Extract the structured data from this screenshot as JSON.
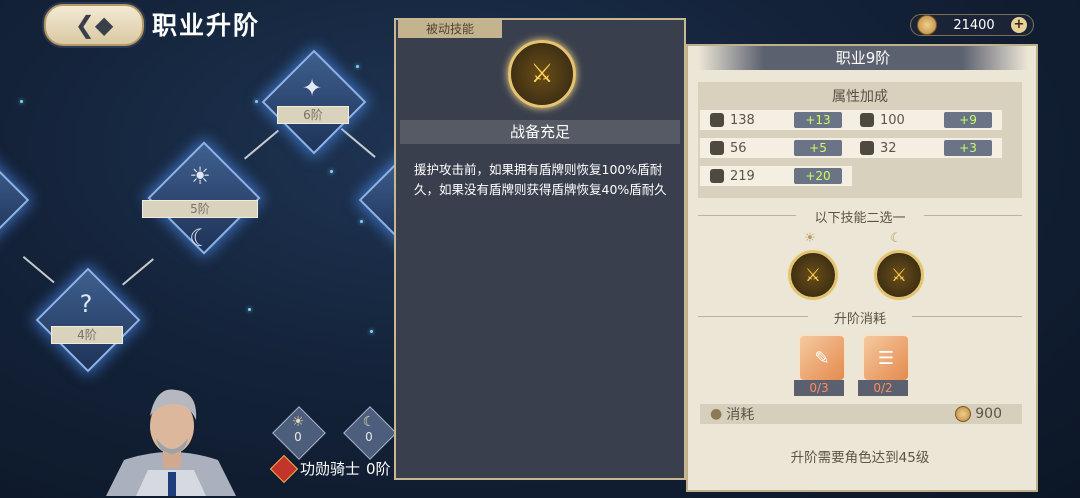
{
  "header": {
    "title": "职业升阶",
    "currency_value": "21400"
  },
  "tree": {
    "nodes": [
      {
        "label": "6阶",
        "icon": "compass-star-icon"
      },
      {
        "label": "5阶",
        "icon": "sun-icon",
        "icon2": "moon-icon"
      },
      {
        "label": "4阶",
        "icon": "question-icon"
      }
    ]
  },
  "character": {
    "sun_points": "0",
    "moon_points": "0",
    "name": "功勋骑士",
    "rank": "0阶"
  },
  "popup": {
    "tab": "被动技能",
    "skill_name": "战备充足",
    "description": "援护攻击前，如果拥有盾牌则恢复100%盾耐久，如果没有盾牌则获得盾牌恢复40%盾耐久"
  },
  "panel": {
    "title": "职业9阶",
    "attr_title": "属性加成",
    "attributes": [
      {
        "icon": "sword-icon",
        "value": "138",
        "bonus": "+13"
      },
      {
        "icon": "magic-wand-icon",
        "value": "100",
        "bonus": "+9"
      },
      {
        "icon": "shield-icon",
        "value": "56",
        "bonus": "+5"
      },
      {
        "icon": "magic-defense-icon",
        "value": "32",
        "bonus": "+3"
      },
      {
        "icon": "heart-icon",
        "value": "219",
        "bonus": "+20"
      }
    ],
    "choose_title": "以下技能二选一",
    "cost_title": "升阶消耗",
    "materials": [
      {
        "icon": "scroll-icon",
        "count": "0/3"
      },
      {
        "icon": "book-icon",
        "count": "0/2"
      }
    ],
    "cost_label": "消耗",
    "cost_value": "900",
    "requirement": "升阶需要角色达到45级"
  }
}
